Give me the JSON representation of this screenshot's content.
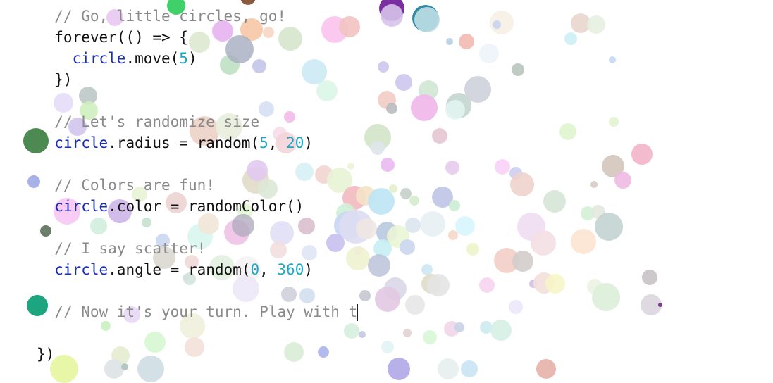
{
  "editor": {
    "lines": [
      [
        {
          "t": "  "
        },
        {
          "t": "// Go, little circles, go!",
          "k": "comment"
        }
      ],
      [
        {
          "t": "  forever(() => {"
        }
      ],
      [
        {
          "t": "    "
        },
        {
          "t": "circle",
          "k": "var"
        },
        {
          "t": ".move("
        },
        {
          "t": "5",
          "k": "num"
        },
        {
          "t": ")"
        }
      ],
      [
        {
          "t": "  })"
        }
      ],
      [],
      [
        {
          "t": "  "
        },
        {
          "t": "// Let's randomize size",
          "k": "comment"
        }
      ],
      [
        {
          "t": "  "
        },
        {
          "t": "circle",
          "k": "var"
        },
        {
          "t": ".radius = random("
        },
        {
          "t": "5",
          "k": "num"
        },
        {
          "t": ", "
        },
        {
          "t": "20",
          "k": "num"
        },
        {
          "t": ")"
        }
      ],
      [],
      [
        {
          "t": "  "
        },
        {
          "t": "// Colors are fun!",
          "k": "comment"
        }
      ],
      [
        {
          "t": "  "
        },
        {
          "t": "circle",
          "k": "var"
        },
        {
          "t": ".color = randomColor()"
        }
      ],
      [],
      [
        {
          "t": "  "
        },
        {
          "t": "// I say scatter!",
          "k": "comment"
        }
      ],
      [
        {
          "t": "  "
        },
        {
          "t": "circle",
          "k": "var"
        },
        {
          "t": ".angle = random("
        },
        {
          "t": "0",
          "k": "num"
        },
        {
          "t": ", "
        },
        {
          "t": "360",
          "k": "num"
        },
        {
          "t": ")"
        }
      ],
      [],
      [
        {
          "t": "  "
        },
        {
          "t": "// Now it's your turn. Play with t",
          "k": "comment"
        }
      ],
      [],
      [
        {
          "t": "})"
        }
      ]
    ],
    "caret_line": 14
  },
  "colors": {
    "comment": "#8a8a8a",
    "keyword_var": "#1a2fb0",
    "number": "#1ea7c4",
    "text": "#111111"
  }
}
